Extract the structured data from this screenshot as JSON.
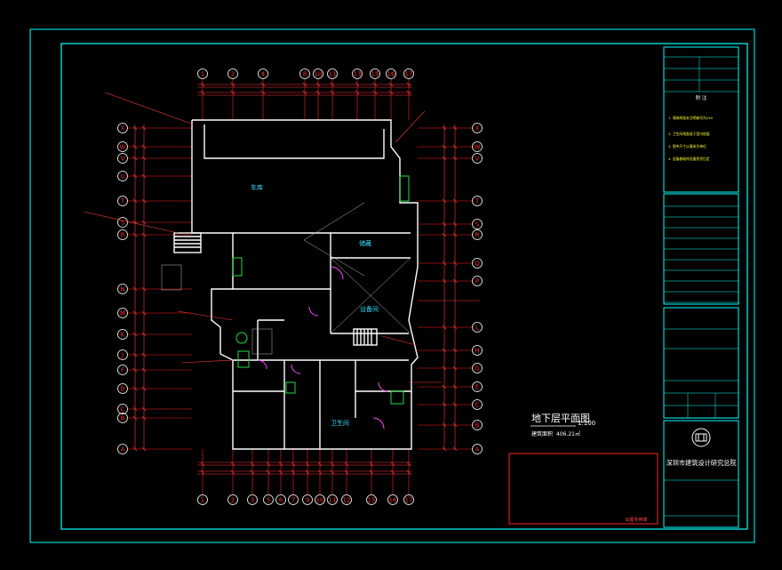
{
  "drawing": {
    "title": "地下层平面图",
    "scale": "1:100",
    "area_label": "建筑面积",
    "area_value": "406.21㎡"
  },
  "grid": {
    "columns_top": [
      "1",
      "2",
      "4",
      "8",
      "10",
      "11",
      "13",
      "15",
      "16",
      "17"
    ],
    "columns_bottom": [
      "1",
      "2",
      "3",
      "5",
      "6",
      "7",
      "9",
      "10",
      "11",
      "12",
      "15",
      "16",
      "17"
    ],
    "rows_left": [
      "X",
      "W",
      "V",
      "U",
      "T",
      "S",
      "R",
      "N",
      "M",
      "K",
      "J",
      "F",
      "D",
      "C",
      "B",
      "A"
    ],
    "rows_right": [
      "X",
      "W",
      "V",
      "T",
      "S",
      "R",
      "Q",
      "P",
      "L",
      "H",
      "G",
      "E",
      "C",
      "B",
      "A"
    ]
  },
  "rooms": {
    "garage": "车库",
    "equipment": "设备间",
    "storage": "储藏",
    "bath": "卫生间"
  },
  "title_block": {
    "notes_heading": "附 注",
    "notes": [
      "1. 墙体厚度未注明者均为240",
      "2. 卫生间地面低于室内地面",
      "3. 图中尺寸以毫米为单位",
      "4. 设备基础待设备到货后定"
    ],
    "institute_name": "深圳市建筑设计研究总院",
    "stamp_label": "出图专用章"
  },
  "colors": {
    "frame": "#00ffff",
    "gridline": "#ff2222",
    "wall": "#ffffff",
    "dimension": "#ff3b3b",
    "door": "#ff44ff",
    "fixture": "#22dd44",
    "annotation": "#ffff33"
  }
}
